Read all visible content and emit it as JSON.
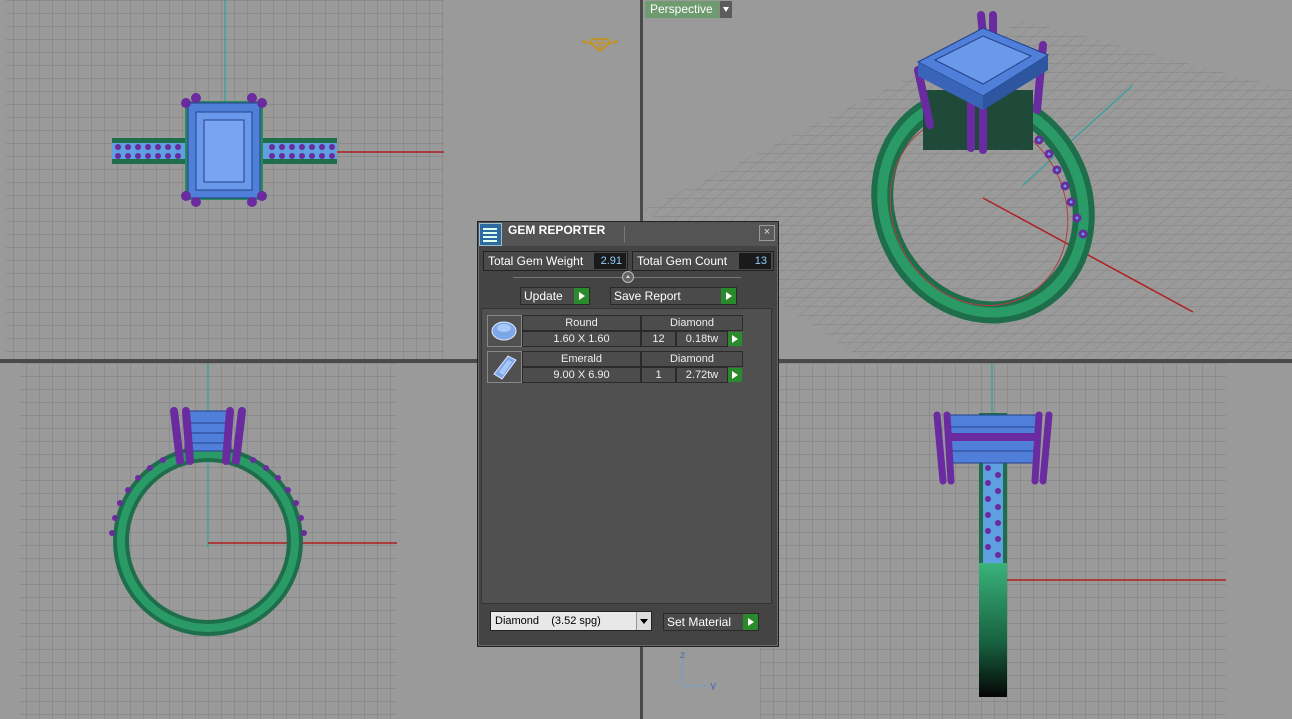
{
  "viewports": {
    "perspective_label": "Perspective"
  },
  "axis_tripod": {
    "z": "z",
    "y": "y"
  },
  "gem_reporter": {
    "title": "GEM REPORTER",
    "close_icon": "close-icon",
    "total_weight_label": "Total Gem Weight",
    "total_weight_value": "2.91",
    "total_count_label": "Total Gem Count",
    "total_count_value": "13",
    "update_label": "Update",
    "save_report_label": "Save Report",
    "gems": [
      {
        "cut": "Round",
        "size": "1.60 X 1.60",
        "material": "Diamond",
        "count": "12",
        "weight": "0.18tw",
        "icon": "round-gem-icon"
      },
      {
        "cut": "Emerald",
        "size": "9.00 X 6.90",
        "material": "Diamond",
        "count": "1",
        "weight": "2.72tw",
        "icon": "emerald-gem-icon"
      }
    ],
    "material_select_value": "Diamond    (3.52 spg)",
    "set_material_label": "Set Material"
  },
  "colors": {
    "band": "#2a8a5f",
    "gem": "#5f8fe0",
    "prong": "#6a2aa0",
    "grid_bg": "#9a9a9a",
    "x_axis": "#b02020",
    "y_axis": "#20a0a0"
  }
}
